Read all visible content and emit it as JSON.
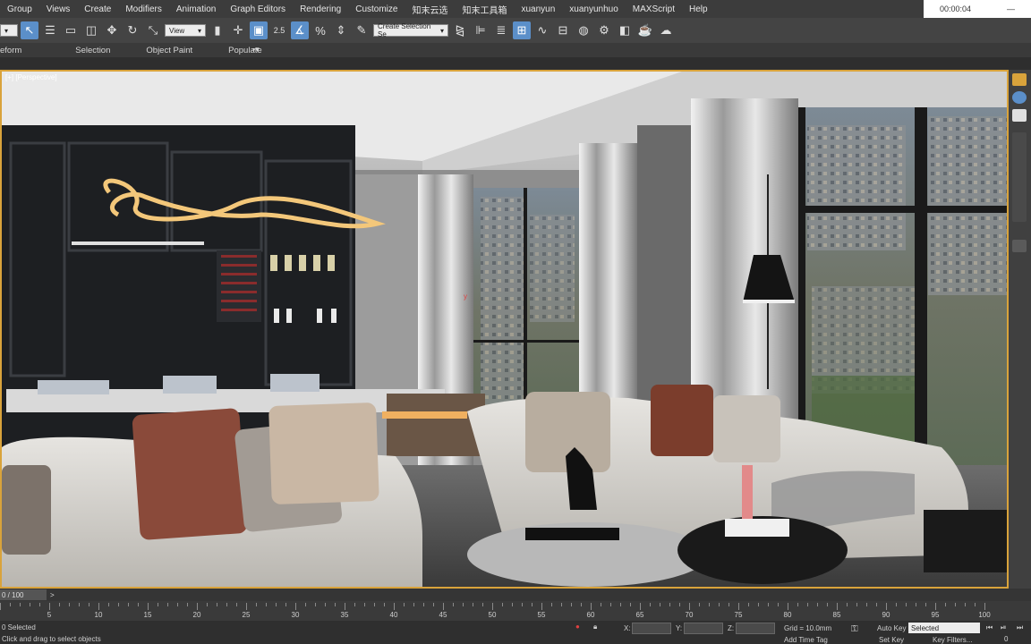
{
  "menu": [
    "Group",
    "Views",
    "Create",
    "Modifiers",
    "Animation",
    "Graph Editors",
    "Rendering",
    "Customize",
    "知末云选",
    "知末工具箱",
    "xuanyun",
    "xuanyunhuo",
    "MAXScript",
    "Help"
  ],
  "timer": "00:00:04",
  "toolbar": {
    "view_dropdown": "View",
    "selection_set_placeholder": "Create Selection Se",
    "snap_label": "2.5"
  },
  "ribbon": [
    "eform",
    "Selection",
    "Object Paint",
    "Populate"
  ],
  "viewport": {
    "label": "[+] [Perspective]"
  },
  "timeslider": {
    "frame": "0 / 100",
    "next": ">"
  },
  "timeline_ticks": [
    "5",
    "10",
    "15",
    "20",
    "25",
    "30",
    "35",
    "40",
    "45",
    "50",
    "55",
    "60",
    "65",
    "70",
    "75",
    "80",
    "85",
    "90",
    "95",
    "100"
  ],
  "status": {
    "selected": "0 Selected",
    "prompt": "Click and drag to select objects",
    "x_label": "X:",
    "y_label": "Y:",
    "z_label": "Z:",
    "grid": "Grid = 10.0mm",
    "add_time_tag": "Add Time Tag",
    "auto_key": "Auto Key",
    "set_key": "Set Key",
    "key_filters": "Key Filters...",
    "selected_dropdown": "Selected",
    "frame_field": "0"
  },
  "colors": {
    "accent_blue": "#5b8fc9",
    "viewport_border": "#d9a33b",
    "menubar": "#3c3c3c"
  }
}
